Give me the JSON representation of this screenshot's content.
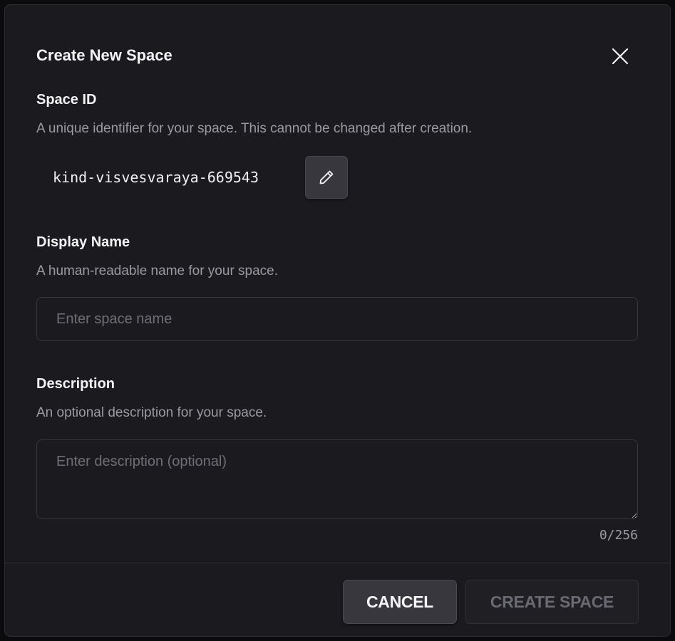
{
  "dialog": {
    "title": "Create New Space",
    "close_icon": "close-icon"
  },
  "space_id": {
    "label": "Space ID",
    "help": "A unique identifier for your space. This cannot be changed after creation.",
    "value": "kind-visvesvaraya-669543",
    "edit_icon": "pencil-icon"
  },
  "display_name": {
    "label": "Display Name",
    "help": "A human-readable name for your space.",
    "value": "",
    "placeholder": "Enter space name"
  },
  "description": {
    "label": "Description",
    "help": "An optional description for your space.",
    "value": "",
    "placeholder": "Enter description (optional)",
    "counter": "0/256"
  },
  "footer": {
    "cancel_label": "CANCEL",
    "create_label": "CREATE SPACE"
  },
  "colors": {
    "dialog_bg": "#1b1b1f",
    "primary_text": "#f3f3f5",
    "secondary_text": "#9a9aa2",
    "button_bg": "#37373d",
    "disabled_text": "#6a6a72"
  }
}
